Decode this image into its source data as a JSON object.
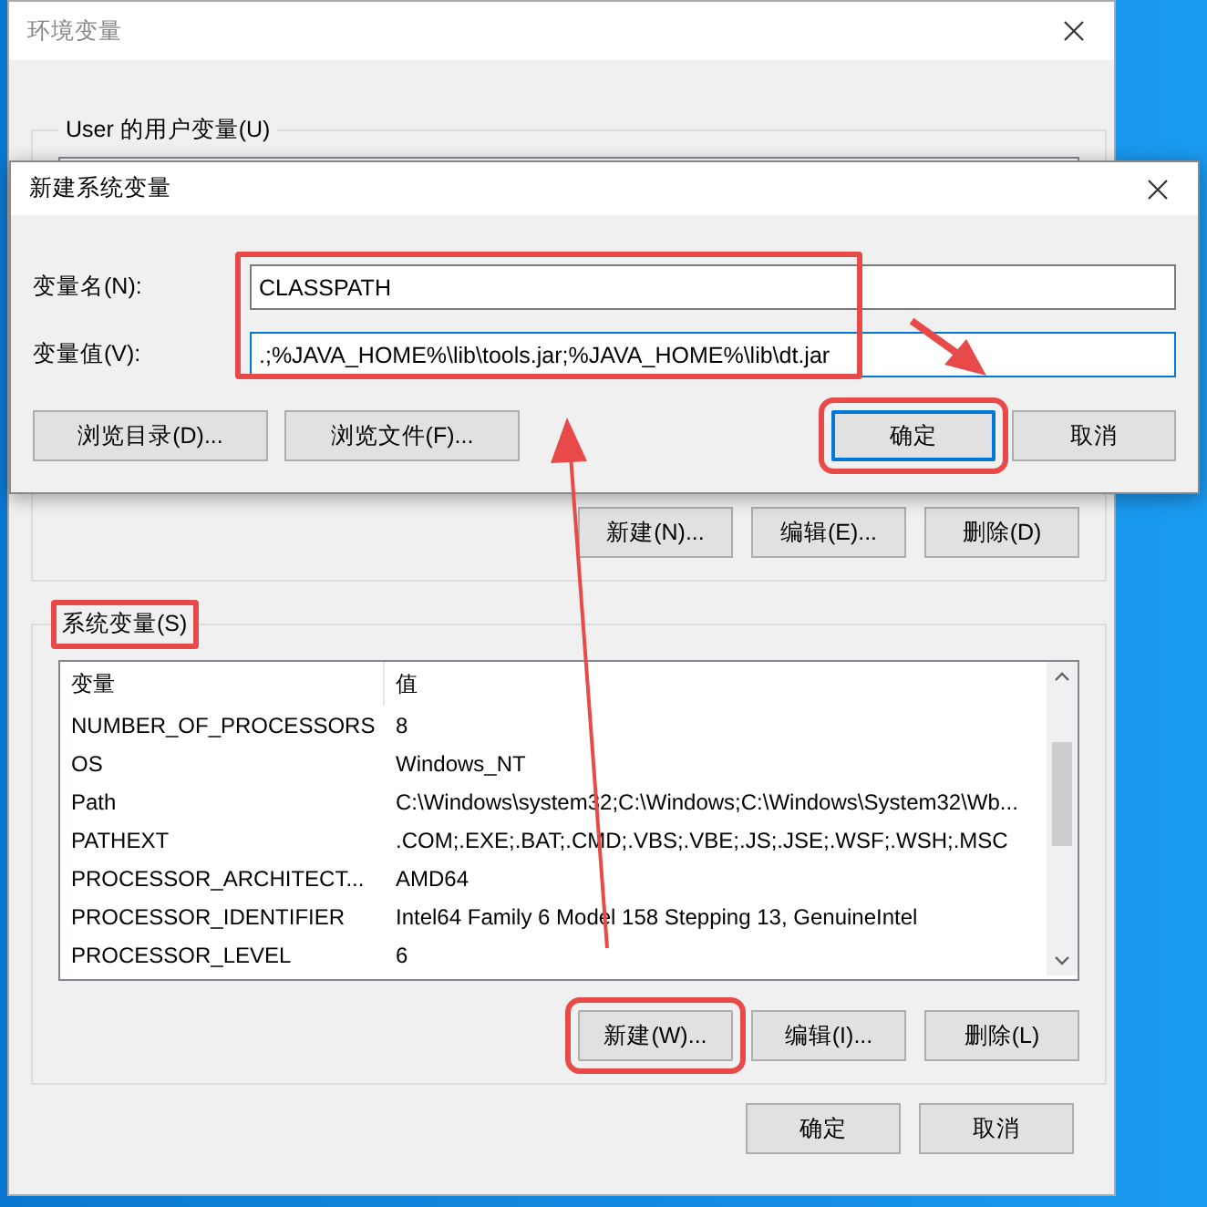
{
  "background_window": {
    "title": "环境变量",
    "user_variables": {
      "label": "User 的用户变量(U)",
      "buttons": [
        {
          "label": "新建(N)...",
          "highlighted": false
        },
        {
          "label": "编辑(E)...",
          "highlighted": false
        },
        {
          "label": "删除(D)",
          "highlighted": false
        }
      ]
    },
    "system_variables": {
      "label": "系统变量(S)",
      "highlighted": true,
      "columns": [
        "变量",
        "值"
      ],
      "rows": [
        {
          "name": "NUMBER_OF_PROCESSORS",
          "value": "8"
        },
        {
          "name": "OS",
          "value": "Windows_NT"
        },
        {
          "name": "Path",
          "value": "C:\\Windows\\system32;C:\\Windows;C:\\Windows\\System32\\Wb..."
        },
        {
          "name": "PATHEXT",
          "value": ".COM;.EXE;.BAT;.CMD;.VBS;.VBE;.JS;.JSE;.WSF;.WSH;.MSC"
        },
        {
          "name": "PROCESSOR_ARCHITECT...",
          "value": "AMD64"
        },
        {
          "name": "PROCESSOR_IDENTIFIER",
          "value": "Intel64 Family 6 Model 158 Stepping 13, GenuineIntel"
        },
        {
          "name": "PROCESSOR_LEVEL",
          "value": "6"
        }
      ],
      "buttons": [
        {
          "label": "新建(W)...",
          "highlighted": true
        },
        {
          "label": "编辑(I)...",
          "highlighted": false
        },
        {
          "label": "删除(L)",
          "highlighted": false
        }
      ]
    },
    "buttons": [
      "确定",
      "取消"
    ]
  },
  "dialog": {
    "title": "新建系统变量",
    "fields_highlighted": true,
    "fields": [
      {
        "label": "变量名(N):",
        "value": "CLASSPATH",
        "focused": false
      },
      {
        "label": "变量值(V):",
        "value": ".;%JAVA_HOME%\\lib\\tools.jar;%JAVA_HOME%\\lib\\dt.jar",
        "focused": true
      }
    ],
    "left_buttons": [
      {
        "label": "浏览目录(D)...",
        "default": false,
        "highlighted": false
      },
      {
        "label": "浏览文件(F)...",
        "default": false,
        "highlighted": false
      }
    ],
    "right_buttons": [
      {
        "label": "确定",
        "default": true,
        "highlighted": true
      },
      {
        "label": "取消",
        "default": false,
        "highlighted": false
      }
    ]
  }
}
